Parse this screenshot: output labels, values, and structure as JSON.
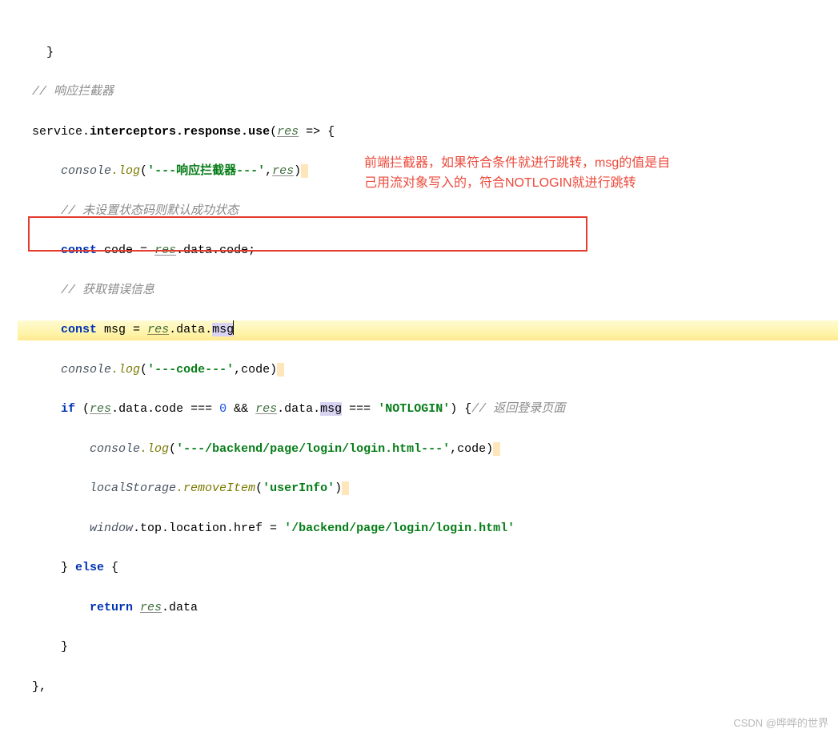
{
  "lines": {
    "l0": "}",
    "c1": "// 响应拦截器",
    "l2_a": "service.",
    "l2_b": "interceptors.response.use",
    "l2_c": "(",
    "l2_res": "res",
    "l2_d": " => {",
    "l3_console": "console",
    "l3_log": ".log",
    "l3_openp": "(",
    "l3_str": "'---响应拦截器---'",
    "l3_comma": ",",
    "l3_res": "res",
    "l3_closep": ")",
    "c4": "// 未设置状态码则默认成功状态",
    "l5_const": "const ",
    "l5_code": "code",
    "l5_eq": " = ",
    "l5_res": "res",
    "l5_datacode": ".data.code;",
    "c6": "// 获取错误信息",
    "l7_const": "const ",
    "l7_msgdef": "msg",
    "l7_eq": " = ",
    "l7_res": "res",
    "l7_p1": ".data.",
    "l7_msg": "msg",
    "l8_console": "console",
    "l8_log": ".log",
    "l8_openp": "(",
    "l8_str": "'---code---'",
    "l8_comma": ",",
    "l8_codearg": "code",
    "l8_closep": ")",
    "l9_if": "if ",
    "l9_openp": "(",
    "l9_res1": "res",
    "l9_p1": ".data.code === ",
    "l9_zero": "0",
    "l9_and": " && ",
    "l9_res2": "res",
    "l9_p2": ".data.",
    "l9_msg": "msg",
    "l9_eq2": " === ",
    "l9_str": "'NOTLOGIN'",
    "l9_closep": ") {",
    "c9": "// 返回登录页面",
    "l10_console": "console",
    "l10_log": ".log",
    "l10_openp": "(",
    "l10_str": "'---/backend/page/login/login.html---'",
    "l10_comma": ",",
    "l10_codearg": "code",
    "l10_closep": ")",
    "l11_ls": "localStorage",
    "l11_rem": ".removeItem",
    "l11_openp": "(",
    "l11_str": "'userInfo'",
    "l11_closep": ")",
    "l12_win": "window",
    "l12_p1": ".top.location.href = ",
    "l12_str": "'/backend/page/login/login.html'",
    "l13_close": "} ",
    "l13_else": "else",
    "l13_open": " {",
    "l14_ret": "return ",
    "l14_res": "res",
    "l14_data": ".data",
    "l15": "}",
    "l16": "},"
  },
  "annotation": {
    "line1": "前端拦截器，如果符合条件就进行跳转，msg的值是自",
    "line2": "己用流对象写入的，符合NOTLOGIN就进行跳转"
  },
  "watermark": "CSDN @哗哗的世界"
}
